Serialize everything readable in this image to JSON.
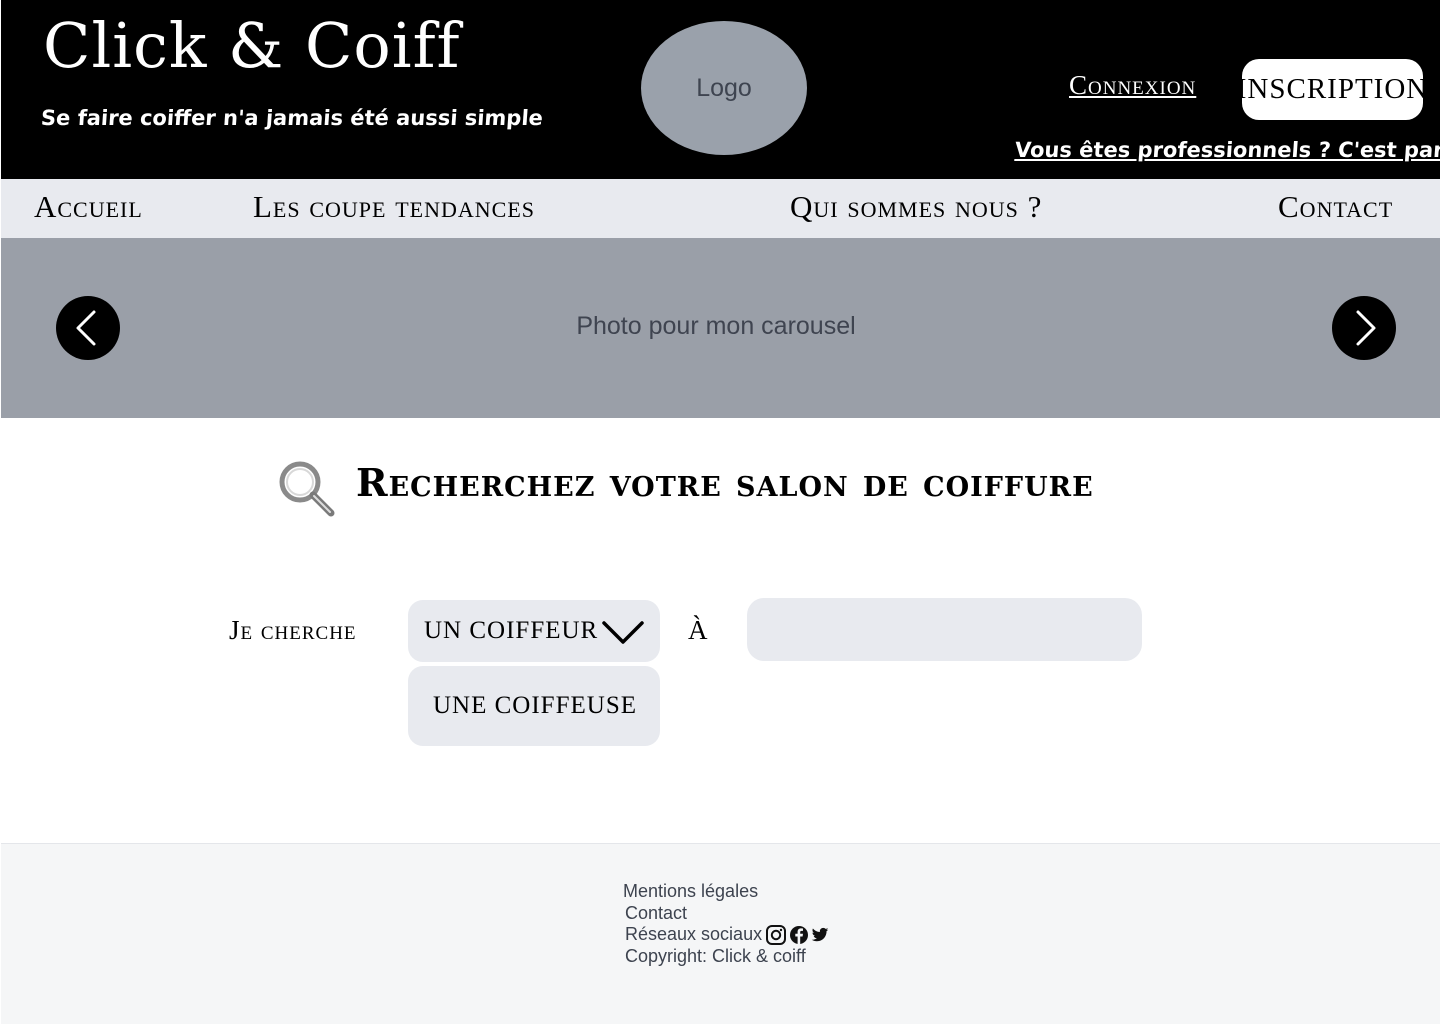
{
  "header": {
    "brand": "Click & Coiff",
    "tagline": "Se faire coiffer n'a jamais été aussi simple",
    "logo_text": "Logo",
    "connexion_label": "Connexion",
    "inscription_label": "INSCRIPTION",
    "pro_link": "Vous êtes professionnels ? C'est par ici"
  },
  "nav": {
    "items": [
      {
        "label": "Accueil"
      },
      {
        "label": "Les coupe tendances"
      },
      {
        "label": "Qui sommes nous ?"
      },
      {
        "label": "Contact"
      }
    ]
  },
  "carousel": {
    "placeholder": "Photo pour mon carousel",
    "prev_icon": "chevron-left-icon",
    "next_icon": "chevron-right-icon"
  },
  "search": {
    "title": "Recherchez votre salon de coiffure",
    "title_icon": "magnifier-icon",
    "je_cherche": "Je cherche",
    "select_value": "UN COIFFEUR",
    "options": [
      "UNE COIFFEUSE"
    ],
    "a_label": "À",
    "city_value": "",
    "city_placeholder": ""
  },
  "footer": {
    "mentions": "Mentions légales",
    "contact": "Contact",
    "social_label": "Réseaux sociaux",
    "social_icons": [
      "instagram-icon",
      "facebook-icon",
      "twitter-icon"
    ],
    "copyright": "Copyright: Click & coiff"
  },
  "colors": {
    "header_bg": "#000000",
    "nav_bg": "#e8eaef",
    "carousel_bg": "#9a9fa8",
    "logo_bg": "#9aa1ab",
    "field_bg": "#e8eaef",
    "footer_bg": "#f5f6f7"
  }
}
